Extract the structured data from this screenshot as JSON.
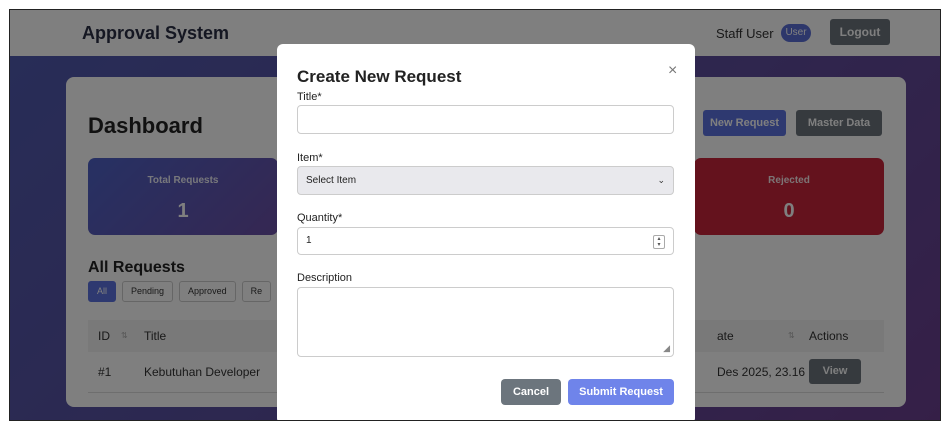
{
  "navbar": {
    "brand": "Approval System",
    "user_name": "Staff User",
    "role_badge": "User",
    "logout_label": "Logout"
  },
  "dashboard": {
    "title": "Dashboard",
    "new_request_label": "New Request",
    "master_data_label": "Master Data",
    "stats": {
      "total_label": "Total Requests",
      "total_value": "1",
      "rejected_label": "Rejected",
      "rejected_value": "0"
    },
    "all_requests_title": "All Requests",
    "filters": [
      "All",
      "Pending",
      "Approved",
      "Re"
    ],
    "table": {
      "headers": {
        "id": "ID",
        "title": "Title",
        "date": "ate",
        "actions": "Actions"
      },
      "rows": [
        {
          "id": "#1",
          "title": "Kebutuhan Developer",
          "date": "Des 2025, 23.16",
          "action": "View"
        }
      ]
    }
  },
  "modal": {
    "title": "Create New Request",
    "close_glyph": "×",
    "title_label": "Title*",
    "title_value": "",
    "item_label": "Item*",
    "item_selected": "Select Item",
    "quantity_label": "Quantity*",
    "quantity_value": "1",
    "description_label": "Description",
    "description_value": "",
    "cancel_label": "Cancel",
    "submit_label": "Submit Request"
  },
  "colors": {
    "primary": "#5d73e0",
    "secondary": "#6c757d",
    "danger": "#c8243a",
    "background_gradient_start": "#4f5bb0",
    "background_gradient_end": "#6b3f8f"
  },
  "icons": {
    "close": "close-icon",
    "select_chevron": "chevron-down-icon",
    "spinner": "spinner-icon",
    "resize_grip": "resize-grip-icon",
    "sort": "sort-icon"
  }
}
